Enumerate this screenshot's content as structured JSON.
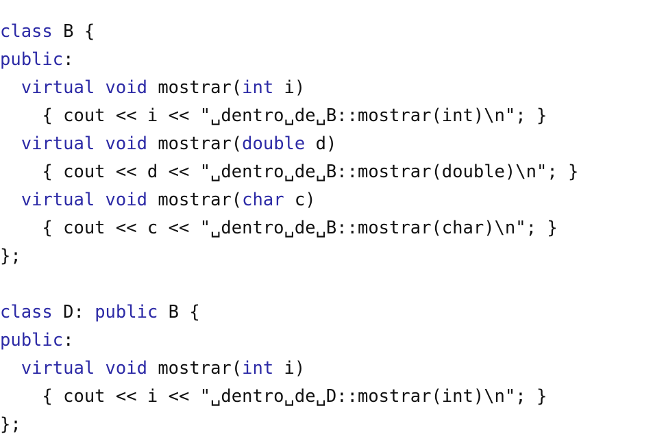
{
  "lines": [
    [
      {
        "t": "class",
        "k": true
      },
      {
        "t": " B {"
      }
    ],
    [
      {
        "t": "public",
        "k": true
      },
      {
        "t": ":"
      }
    ],
    [
      {
        "t": "  "
      },
      {
        "t": "virtual",
        "k": true
      },
      {
        "t": " "
      },
      {
        "t": "void",
        "k": true
      },
      {
        "t": " mostrar("
      },
      {
        "t": "int",
        "k": true
      },
      {
        "t": " i)"
      }
    ],
    [
      {
        "t": "    { cout << i << \"␣dentro␣de␣B::mostrar(int)\\n\"; }"
      }
    ],
    [
      {
        "t": "  "
      },
      {
        "t": "virtual",
        "k": true
      },
      {
        "t": " "
      },
      {
        "t": "void",
        "k": true
      },
      {
        "t": " mostrar("
      },
      {
        "t": "double",
        "k": true
      },
      {
        "t": " d)"
      }
    ],
    [
      {
        "t": "    { cout << d << \"␣dentro␣de␣B::mostrar(double)\\n\"; }"
      }
    ],
    [
      {
        "t": "  "
      },
      {
        "t": "virtual",
        "k": true
      },
      {
        "t": " "
      },
      {
        "t": "void",
        "k": true
      },
      {
        "t": " mostrar("
      },
      {
        "t": "char",
        "k": true
      },
      {
        "t": " c)"
      }
    ],
    [
      {
        "t": "    { cout << c << \"␣dentro␣de␣B::mostrar(char)\\n\"; }"
      }
    ],
    [
      {
        "t": "};"
      }
    ],
    [
      {
        "t": ""
      }
    ],
    [
      {
        "t": "class",
        "k": true
      },
      {
        "t": " D: "
      },
      {
        "t": "public",
        "k": true
      },
      {
        "t": " B {"
      }
    ],
    [
      {
        "t": "public",
        "k": true
      },
      {
        "t": ":"
      }
    ],
    [
      {
        "t": "  "
      },
      {
        "t": "virtual",
        "k": true
      },
      {
        "t": " "
      },
      {
        "t": "void",
        "k": true
      },
      {
        "t": " mostrar("
      },
      {
        "t": "int",
        "k": true
      },
      {
        "t": " i)"
      }
    ],
    [
      {
        "t": "    { cout << i << \"␣dentro␣de␣D::mostrar(int)\\n\"; }"
      }
    ],
    [
      {
        "t": "};"
      }
    ]
  ],
  "colors": {
    "keyword": "#2c2aa6",
    "text": "#111111",
    "background": "#ffffff"
  }
}
